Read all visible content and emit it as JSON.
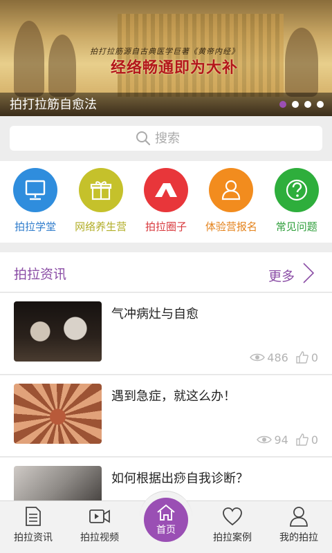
{
  "banner": {
    "subline": "拍打拉筋源自古典医学巨著《黄帝内经》",
    "headline": "经络畅通即为大补",
    "caption": "拍打拉筋自愈法",
    "slides": 4,
    "active_slide": 1
  },
  "search": {
    "placeholder": "搜索"
  },
  "categories": [
    {
      "label": "拍拉学堂",
      "color": "#2f8ddd",
      "label_color": "#2f7ccc",
      "icon": "monitor-icon"
    },
    {
      "label": "网络养生营",
      "color": "#c5c12b",
      "label_color": "#b2ae28",
      "icon": "gift-icon"
    },
    {
      "label": "拍拉圈子",
      "color": "#e8363a",
      "label_color": "#d8383c",
      "icon": "tent-icon"
    },
    {
      "label": "体验营报名",
      "color": "#f28c1e",
      "label_color": "#e4831c",
      "icon": "person-icon"
    },
    {
      "label": "常见问题",
      "color": "#2eae3c",
      "label_color": "#2e9e3a",
      "icon": "question-icon"
    }
  ],
  "news": {
    "title": "拍拉资讯",
    "more": "更多",
    "items": [
      {
        "headline": "气冲病灶与自愈",
        "views": "486",
        "likes": "0"
      },
      {
        "headline": "遇到急症，就这么办！",
        "views": "94",
        "likes": "0"
      },
      {
        "headline": "如何根据出痧自我诊断？",
        "views": "",
        "likes": ""
      }
    ]
  },
  "tabbar": {
    "tabs": [
      {
        "label": "拍拉资讯",
        "icon": "document-icon"
      },
      {
        "label": "拍拉视频",
        "icon": "video-icon"
      },
      {
        "label": "首页",
        "icon": "home-icon"
      },
      {
        "label": "拍拉案例",
        "icon": "heart-icon"
      },
      {
        "label": "我的拍拉",
        "icon": "user-icon"
      }
    ],
    "active_color": "#9a4fb4"
  }
}
